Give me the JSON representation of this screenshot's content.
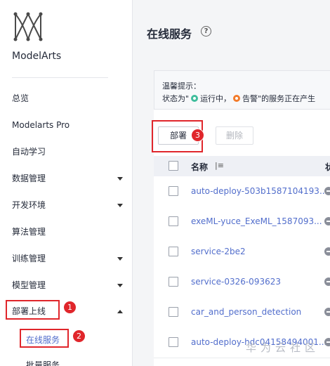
{
  "sidebar": {
    "brand": "ModelArts",
    "items": [
      {
        "label": "总览",
        "has_caret": false
      },
      {
        "label": "Modelarts Pro",
        "has_caret": false
      },
      {
        "label": "自动学习",
        "has_caret": false
      },
      {
        "label": "数据管理",
        "has_caret": true
      },
      {
        "label": "开发环境",
        "has_caret": true
      },
      {
        "label": "算法管理",
        "has_caret": false
      },
      {
        "label": "训练管理",
        "has_caret": true
      },
      {
        "label": "模型管理",
        "has_caret": true
      },
      {
        "label": "部署上线",
        "has_caret": true,
        "expanded": true
      }
    ],
    "sub_items": [
      {
        "label": "在线服务",
        "active": true
      },
      {
        "label": "批量服务",
        "active": false
      }
    ]
  },
  "annotations": {
    "step1": "1",
    "step2": "2",
    "step3": "3",
    "color": "#e0262b"
  },
  "header": {
    "title": "在线服务",
    "help_icon": "question-circle-icon"
  },
  "tip": {
    "title": "温馨提示：",
    "line_prefix": "状态为\"",
    "running_label": "运行中，",
    "alarm_label": "告警",
    "line_suffix": "\"的服务正在产生"
  },
  "toolbar": {
    "deploy_label": "部署",
    "delete_label": "删除"
  },
  "table": {
    "columns": {
      "name": "名称",
      "status": "状"
    },
    "rows": [
      {
        "name": "auto-deploy-503b1587104193..."
      },
      {
        "name": "exeML-yuce_ExeML_1587093..."
      },
      {
        "name": "service-2be2"
      },
      {
        "name": "service-0326-093623"
      },
      {
        "name": "car_and_person_detection"
      },
      {
        "name": "auto-deploy-hdc04158494001..."
      }
    ]
  },
  "watermark": "华为云社区",
  "colors": {
    "accent_link": "#526ecc",
    "running": "#3fbd9c",
    "alarm": "#f37b2a"
  }
}
